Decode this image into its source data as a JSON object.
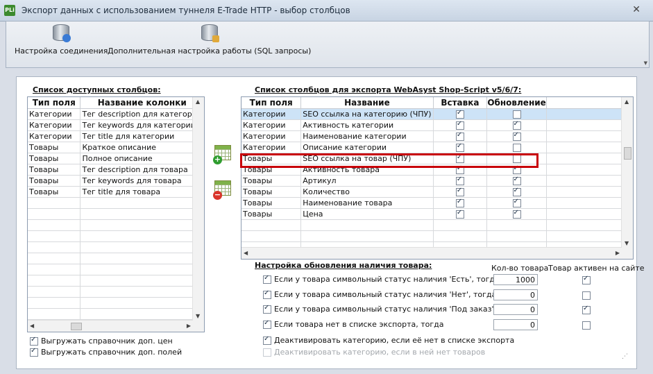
{
  "window": {
    "app_icon_text": "PLi",
    "title": "Экспорт данных с использованием туннеля E-Trade HTTP - выбор столбцов",
    "close_icon": "close-icon"
  },
  "toolbar": {
    "buttons": [
      {
        "label": "Настройка соединения",
        "icon": "database-connection-icon"
      },
      {
        "label": "Дополнительная настройка работы (SQL запросы)",
        "icon": "database-settings-icon"
      }
    ]
  },
  "left": {
    "title": "Список доступных столбцов:",
    "headers": [
      "Тип поля",
      "Название колонки"
    ],
    "rows": [
      {
        "type": "Категории",
        "name": "Тег description для категории"
      },
      {
        "type": "Категории",
        "name": "Тег keywords для категории"
      },
      {
        "type": "Категории",
        "name": "Тег title для категории"
      },
      {
        "type": "Товары",
        "name": "Краткое описание"
      },
      {
        "type": "Товары",
        "name": "Полное описание"
      },
      {
        "type": "Товары",
        "name": "Тег description для товара"
      },
      {
        "type": "Товары",
        "name": "Тег keywords для товара"
      },
      {
        "type": "Товары",
        "name": "Тег title для товара"
      }
    ],
    "empty_rows": 11,
    "checkboxes": [
      {
        "label": "Выгружать справочник доп. цен",
        "checked": true
      },
      {
        "label": "Выгружать справочник доп. полей",
        "checked": true
      }
    ]
  },
  "middle": {
    "add_icon": "add-column-icon",
    "remove_icon": "remove-column-icon"
  },
  "right": {
    "title": "Список столбцов для экспорта WebAsyst Shop-Script v5/6/7:",
    "headers": [
      "Тип поля",
      "Название",
      "Вставка",
      "Обновление"
    ],
    "rows": [
      {
        "type": "Категории",
        "name": "SEO ссылка на категорию (ЧПУ)",
        "insert": true,
        "update": false,
        "selected": true
      },
      {
        "type": "Категории",
        "name": "Активность категории",
        "insert": true,
        "update": true
      },
      {
        "type": "Категории",
        "name": "Наименование категории",
        "insert": true,
        "update": true
      },
      {
        "type": "Категории",
        "name": "Описание категории",
        "insert": true,
        "update": false
      },
      {
        "type": "Товары",
        "name": "SEO ссылка на товар (ЧПУ)",
        "insert": true,
        "update": false,
        "highlighted": true
      },
      {
        "type": "Товары",
        "name": "Активность товара",
        "insert": true,
        "update": true
      },
      {
        "type": "Товары",
        "name": "Артикул",
        "insert": true,
        "update": true
      },
      {
        "type": "Товары",
        "name": "Количество",
        "insert": true,
        "update": true
      },
      {
        "type": "Товары",
        "name": "Наименование товара",
        "insert": true,
        "update": true
      },
      {
        "type": "Товары",
        "name": "Цена",
        "insert": true,
        "update": true
      }
    ],
    "empty_rows": 3,
    "highlight_color": "#c8000a"
  },
  "stock": {
    "title": "Настройка обновления наличия товара:",
    "col_qty": "Кол-во товара",
    "col_active": "Товар активен на сайте",
    "rows": [
      {
        "label": "Если у товара символьный статус наличия 'Есть', тогда",
        "checked": true,
        "qty": "1000",
        "active": true
      },
      {
        "label": "Если у товара символьный статус наличия 'Нет', тогда",
        "checked": true,
        "qty": "0",
        "active": false
      },
      {
        "label": "Если у товара символьный статус наличия 'Под заказ', тогда",
        "checked": true,
        "qty": "0",
        "active": true
      },
      {
        "label": "Если товара нет в списке экспорта, тогда",
        "checked": true,
        "qty": "0",
        "active": false
      }
    ],
    "deactivate": {
      "label": "Деактивировать категорию, если её нет в списке экспорта",
      "checked": true
    },
    "deactivate_empty": {
      "label": "Деактивировать категорию, если в ней нет товаров",
      "checked": false,
      "disabled": true
    }
  }
}
